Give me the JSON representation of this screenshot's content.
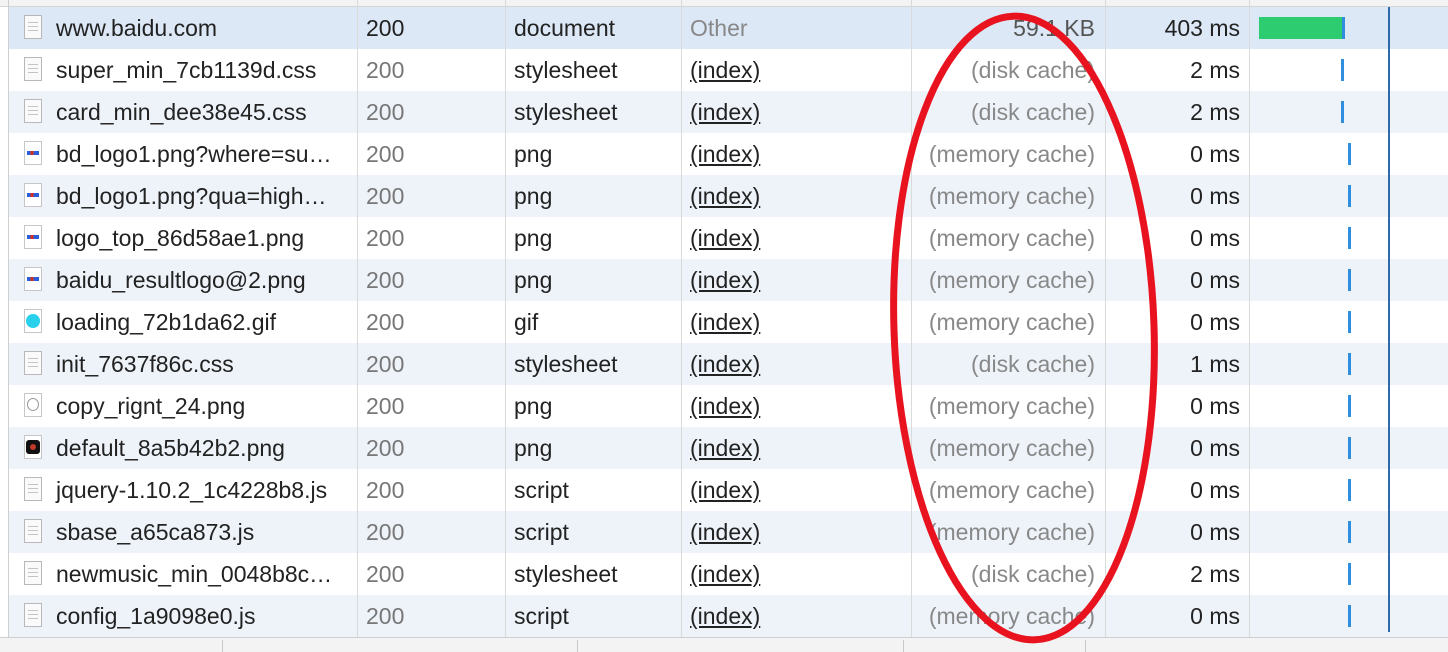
{
  "network": {
    "rows": [
      {
        "name": "www.baidu.com",
        "status": "200",
        "type": "document",
        "initiator": "Other",
        "size": "59.1 KB",
        "time": "403 ms",
        "icon": "document-icon"
      },
      {
        "name": "super_min_7cb1139d.css",
        "status": "200",
        "type": "stylesheet",
        "initiator": "(index)",
        "size": "(disk cache)",
        "time": "2 ms",
        "icon": "stylesheet-file-icon"
      },
      {
        "name": "card_min_dee38e45.css",
        "status": "200",
        "type": "stylesheet",
        "initiator": "(index)",
        "size": "(disk cache)",
        "time": "2 ms",
        "icon": "stylesheet-file-icon"
      },
      {
        "name": "bd_logo1.png?where=su…",
        "status": "200",
        "type": "png",
        "initiator": "(index)",
        "size": "(memory cache)",
        "time": "0 ms",
        "icon": "baidu-logo-thumbnail-icon"
      },
      {
        "name": "bd_logo1.png?qua=high…",
        "status": "200",
        "type": "png",
        "initiator": "(index)",
        "size": "(memory cache)",
        "time": "0 ms",
        "icon": "baidu-logo-thumbnail-icon"
      },
      {
        "name": "logo_top_86d58ae1.png",
        "status": "200",
        "type": "png",
        "initiator": "(index)",
        "size": "(memory cache)",
        "time": "0 ms",
        "icon": "baidu-logo-thumbnail-icon"
      },
      {
        "name": "baidu_resultlogo@2.png",
        "status": "200",
        "type": "png",
        "initiator": "(index)",
        "size": "(memory cache)",
        "time": "0 ms",
        "icon": "baidu-logo-thumbnail-icon"
      },
      {
        "name": "loading_72b1da62.gif",
        "status": "200",
        "type": "gif",
        "initiator": "(index)",
        "size": "(memory cache)",
        "time": "0 ms",
        "icon": "loading-circle-icon"
      },
      {
        "name": "init_7637f86c.css",
        "status": "200",
        "type": "stylesheet",
        "initiator": "(index)",
        "size": "(disk cache)",
        "time": "1 ms",
        "icon": "stylesheet-file-icon"
      },
      {
        "name": "copy_rignt_24.png",
        "status": "200",
        "type": "png",
        "initiator": "(index)",
        "size": "(memory cache)",
        "time": "0 ms",
        "icon": "copyright-badge-icon"
      },
      {
        "name": "default_8a5b42b2.png",
        "status": "200",
        "type": "png",
        "initiator": "(index)",
        "size": "(memory cache)",
        "time": "0 ms",
        "icon": "default-avatar-icon"
      },
      {
        "name": "jquery-1.10.2_1c4228b8.js",
        "status": "200",
        "type": "script",
        "initiator": "(index)",
        "size": "(memory cache)",
        "time": "0 ms",
        "icon": "script-file-icon"
      },
      {
        "name": "sbase_a65ca873.js",
        "status": "200",
        "type": "script",
        "initiator": "(index)",
        "size": "(memory cache)",
        "time": "0 ms",
        "icon": "script-file-icon"
      },
      {
        "name": "newmusic_min_0048b8c…",
        "status": "200",
        "type": "stylesheet",
        "initiator": "(index)",
        "size": "(disk cache)",
        "time": "2 ms",
        "icon": "stylesheet-file-icon"
      },
      {
        "name": "config_1a9098e0.js",
        "status": "200",
        "type": "script",
        "initiator": "(index)",
        "size": "(memory cache)",
        "time": "0 ms",
        "icon": "script-file-icon"
      }
    ]
  },
  "colors": {
    "selected_row": "#dce8f6",
    "stripe_row": "#eef3fa",
    "waterfall_waiting": "#2ecc71",
    "waterfall_receiving": "#2f8ee0",
    "dom_content_loaded_line": "#2d6aa8",
    "annotation_ellipse": "#e8131f"
  }
}
